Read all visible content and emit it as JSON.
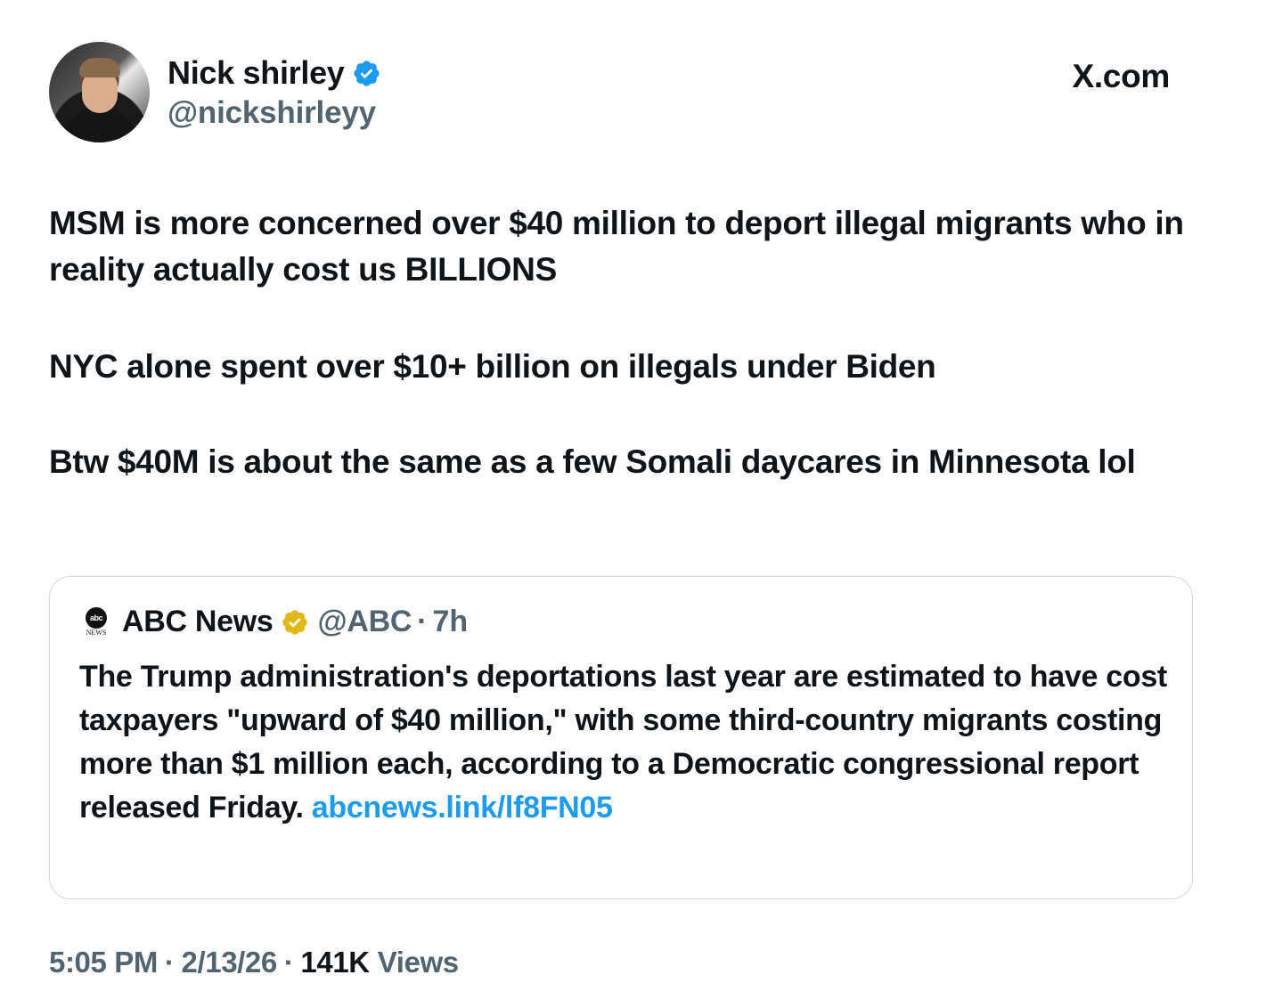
{
  "author": {
    "display_name": "Nick shirley",
    "handle": "@nickshirleyy",
    "verified": "blue-verified-badge"
  },
  "site_label": "X.com",
  "tweet": {
    "paragraphs": [
      "MSM is more concerned over $40 million to deport illegal migrants who in reality actually cost us BILLIONS",
      "NYC alone spent over $10+ billion on illegals under Biden",
      "Btw $40M is about the same as a few Somali daycares in Minnesota lol"
    ]
  },
  "quoted_tweet": {
    "display_name": "ABC News",
    "handle": "@ABC",
    "separator": "·",
    "time": "7h",
    "logo_text": "abc",
    "logo_sub": "NEWS",
    "verified": "gold-verified-badge",
    "text": "The Trump administration's deportations last year are estimated to have cost taxpayers \"upward of $40 million,\" with some third-country migrants costing more than $1 million each, according to a Democratic congressional report released Friday. ",
    "link": "abcnews.link/lf8FN05"
  },
  "footer": {
    "time": "5:05 PM",
    "sep1": "·",
    "date": "2/13/26",
    "sep2": "·",
    "views_count": "141K",
    "views_label": "Views"
  },
  "colors": {
    "text": "#0f1419",
    "secondary": "#536471",
    "link": "#1d9bf0",
    "border": "#cfd9de",
    "verified_blue": "#1d9bf0",
    "verified_gold": "#e2b719"
  }
}
